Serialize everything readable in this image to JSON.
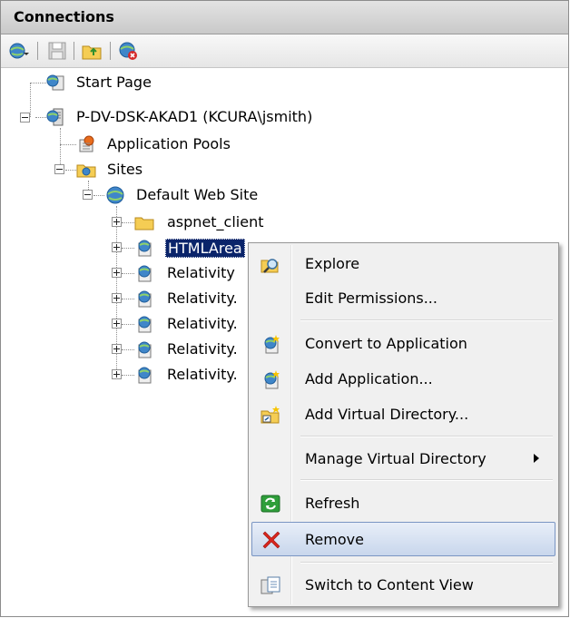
{
  "panel": {
    "title": "Connections"
  },
  "toolbar": {
    "buttons": [
      {
        "icon": "globe-connect-icon"
      },
      {
        "icon": "save-icon"
      },
      {
        "icon": "folder-up-icon"
      },
      {
        "icon": "disconnect-icon"
      }
    ]
  },
  "tree": {
    "start_page": "Start Page",
    "server": "P-DV-DSK-AKAD1 (KCURA\\jsmith)",
    "app_pools": "Application Pools",
    "sites": "Sites",
    "default_site": "Default Web Site",
    "children": [
      "aspnet_client",
      "HTMLArea",
      "Relativity",
      "Relativity.",
      "Relativity.",
      "Relativity.",
      "Relativity."
    ]
  },
  "context_menu": {
    "items": [
      {
        "label": "Explore",
        "icon": "explore-icon"
      },
      {
        "label": "Edit Permissions..."
      },
      {
        "label": "Convert to Application",
        "icon": "convert-app-icon"
      },
      {
        "label": "Add Application...",
        "icon": "add-app-icon"
      },
      {
        "label": "Add Virtual Directory...",
        "icon": "add-vdir-icon"
      },
      {
        "label": "Manage Virtual Directory"
      },
      {
        "label": "Refresh",
        "icon": "refresh-icon"
      },
      {
        "label": "Remove",
        "icon": "remove-icon"
      },
      {
        "label": "Switch to Content View",
        "icon": "content-view-icon"
      }
    ],
    "highlighted": "Remove"
  },
  "colors": {
    "selection": "#0a246a",
    "highlight_border": "#7a95c3"
  }
}
